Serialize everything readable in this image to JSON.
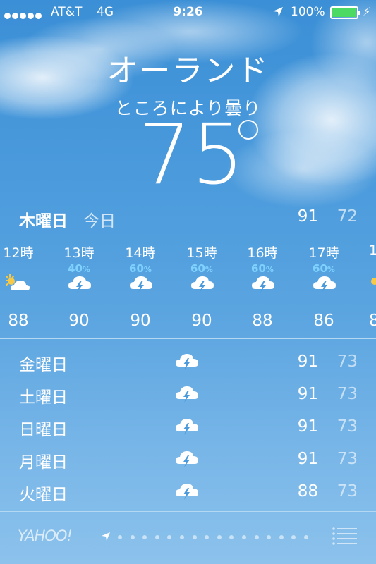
{
  "status_bar": {
    "carrier": "AT&T",
    "network": "4G",
    "time": "9:26",
    "battery": "100%",
    "battery_color": "#4cd964"
  },
  "location": {
    "city": "オーランド",
    "condition": "ところにより曇り",
    "temperature": "75"
  },
  "today": {
    "day": "木曜日",
    "label": "今日",
    "high": "91",
    "low": "72"
  },
  "hourly": [
    {
      "hour": "12時",
      "precip": "",
      "icon": "partly-sunny-icon",
      "temp": "88"
    },
    {
      "hour": "13時",
      "precip": "40",
      "icon": "thunderstorm-icon",
      "temp": "90"
    },
    {
      "hour": "14時",
      "precip": "60",
      "icon": "thunderstorm-icon",
      "temp": "90"
    },
    {
      "hour": "15時",
      "precip": "60",
      "icon": "thunderstorm-icon",
      "temp": "90"
    },
    {
      "hour": "16時",
      "precip": "60",
      "icon": "thunderstorm-icon",
      "temp": "88"
    },
    {
      "hour": "17時",
      "precip": "60",
      "icon": "thunderstorm-icon",
      "temp": "86"
    },
    {
      "hour": "1",
      "precip": "",
      "icon": "partly-sunny-icon",
      "temp": "8"
    }
  ],
  "percent_sign": "%",
  "daily": [
    {
      "day": "金曜日",
      "icon": "thunderstorm-icon",
      "high": "91",
      "low": "73"
    },
    {
      "day": "土曜日",
      "icon": "thunderstorm-icon",
      "high": "91",
      "low": "73"
    },
    {
      "day": "日曜日",
      "icon": "thunderstorm-icon",
      "high": "91",
      "low": "73"
    },
    {
      "day": "月曜日",
      "icon": "thunderstorm-icon",
      "high": "91",
      "low": "73"
    },
    {
      "day": "火曜日",
      "icon": "thunderstorm-icon",
      "high": "88",
      "low": "73"
    }
  ],
  "footer": {
    "brand": "YAHOO!",
    "page_count": 16,
    "current_page": 1
  },
  "colors": {
    "precip_text": "#7fd2ff",
    "sun": "#f7c948"
  }
}
